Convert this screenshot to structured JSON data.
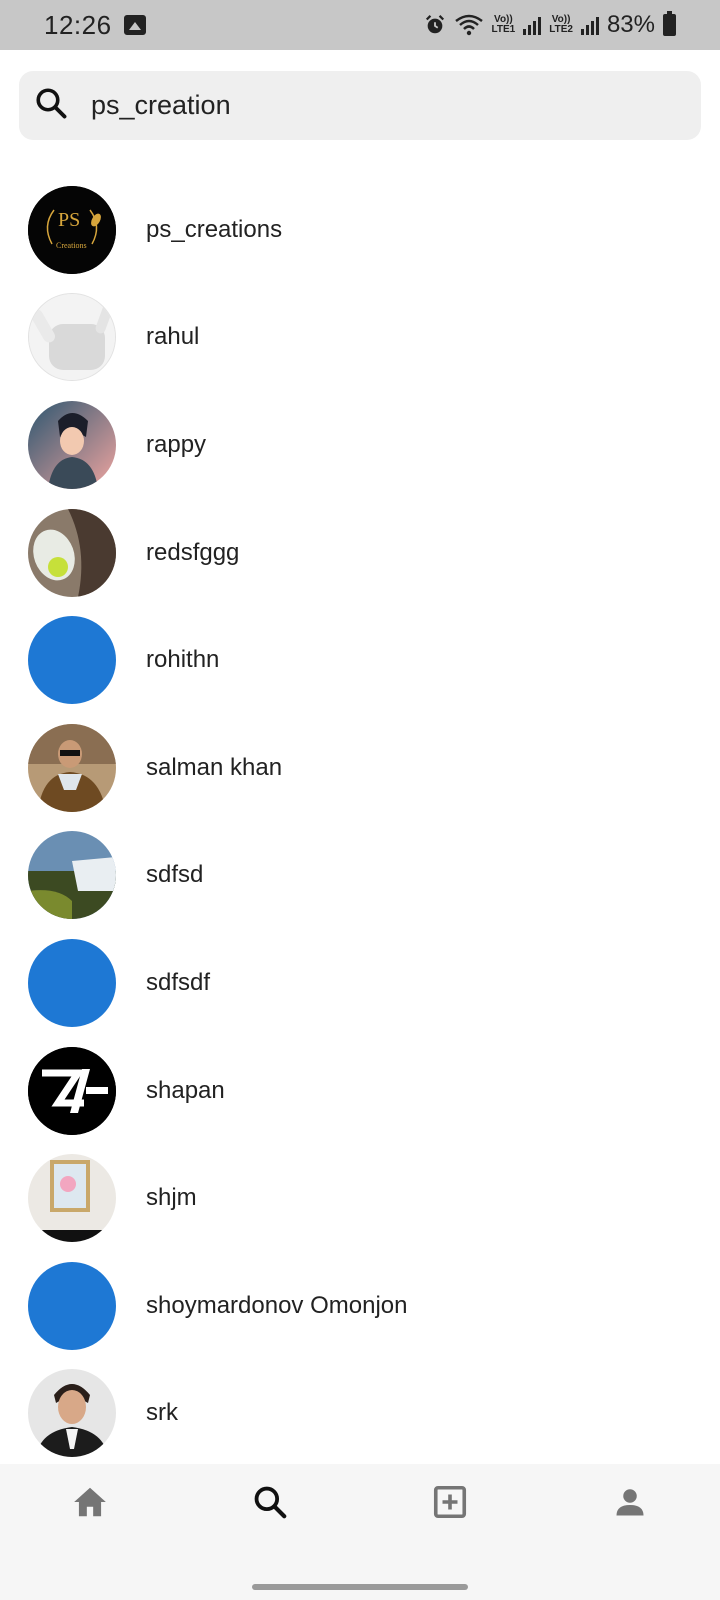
{
  "status_bar": {
    "time": "12:26",
    "sim1_label_top": "Vo))",
    "sim1_label_bottom": "LTE1",
    "sim2_label_top": "Vo))",
    "sim2_label_bottom": "LTE2",
    "battery": "83%"
  },
  "search": {
    "value": "ps_creation"
  },
  "users": [
    {
      "name": "ps_creations",
      "avatar": "ps-creations-logo"
    },
    {
      "name": "rahul",
      "avatar": "earbuds-photo"
    },
    {
      "name": "rappy",
      "avatar": "anime-boy"
    },
    {
      "name": "redsfggg",
      "avatar": "gadget-photo"
    },
    {
      "name": "rohithn",
      "avatar": "blue-default",
      "color": "#1e78d4"
    },
    {
      "name": "salman khan",
      "avatar": "person-photo"
    },
    {
      "name": "sdfsd",
      "avatar": "waterfall-photo"
    },
    {
      "name": "sdfsdf",
      "avatar": "blue-default",
      "color": "#1e78d4"
    },
    {
      "name": "shapan",
      "avatar": "zi-logo"
    },
    {
      "name": "shjm",
      "avatar": "frame-photo"
    },
    {
      "name": "shoymardonov Omonjon",
      "avatar": "blue-default",
      "color": "#1e78d4"
    },
    {
      "name": "srk",
      "avatar": "person-photo-2"
    }
  ],
  "logo_text": {
    "ps": "PS",
    "creations": "Creations"
  },
  "nav": {
    "items": [
      "home-icon",
      "search-icon",
      "add-post-icon",
      "profile-icon"
    ],
    "active": "search-icon"
  }
}
